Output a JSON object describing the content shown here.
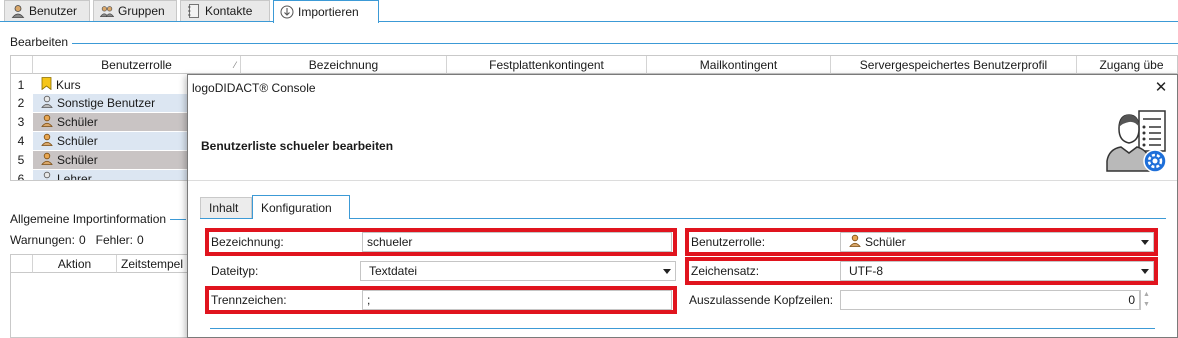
{
  "tabs": [
    {
      "label": "Benutzer",
      "icon": "user-icon"
    },
    {
      "label": "Gruppen",
      "icon": "group-icon"
    },
    {
      "label": "Kontakte",
      "icon": "contacts-icon"
    },
    {
      "label": "Importieren",
      "icon": "import-icon"
    }
  ],
  "background": {
    "edit_section": "Bearbeiten",
    "columns": [
      "Benutzerrolle",
      "Bezeichnung",
      "Festplattenkontingent",
      "Mailkontingent",
      "Servergespeichertes Benutzerprofil",
      "Zugang übe"
    ],
    "rows": [
      {
        "num": "1",
        "role": "Kurs",
        "icon": "bookmark-icon"
      },
      {
        "num": "2",
        "role": "Sonstige Benutzer",
        "icon": "user-icon"
      },
      {
        "num": "3",
        "role": "Schüler",
        "icon": "student-icon"
      },
      {
        "num": "4",
        "role": "Schüler",
        "icon": "student-icon"
      },
      {
        "num": "5",
        "role": "Schüler",
        "icon": "student-icon"
      },
      {
        "num": "6",
        "role": "Lehrer",
        "icon": "user-icon"
      }
    ],
    "import_info": "Allgemeine Importinformation",
    "warnings_label": "Warnungen:",
    "warnings": "0",
    "errors_label": "Fehler:",
    "errors": "0",
    "log_columns": [
      "Aktion",
      "Zeitstempel"
    ]
  },
  "dialog": {
    "title": "logoDIDACT® Console",
    "heading": "Benutzerliste schueler bearbeiten",
    "tabs": [
      "Inhalt",
      "Konfiguration"
    ],
    "active_tab": "Konfiguration",
    "fields": {
      "bezeichnung_label": "Bezeichnung:",
      "bezeichnung_value": "schueler",
      "dateityp_label": "Dateityp:",
      "dateityp_value": "Textdatei",
      "trennzeichen_label": "Trennzeichen:",
      "trennzeichen_value": ";",
      "benutzerrolle_label": "Benutzerrolle:",
      "benutzerrolle_value": "Schüler",
      "zeichensatz_label": "Zeichensatz:",
      "zeichensatz_value": "UTF-8",
      "kopfzeilen_label": "Auszulassende Kopfzeilen:",
      "kopfzeilen_value": "0"
    }
  },
  "colors": {
    "accent": "#3c9ad6",
    "highlight": "#e0141e",
    "row_selected": "#c9c4c4",
    "row_alt": "#dce6f2"
  }
}
